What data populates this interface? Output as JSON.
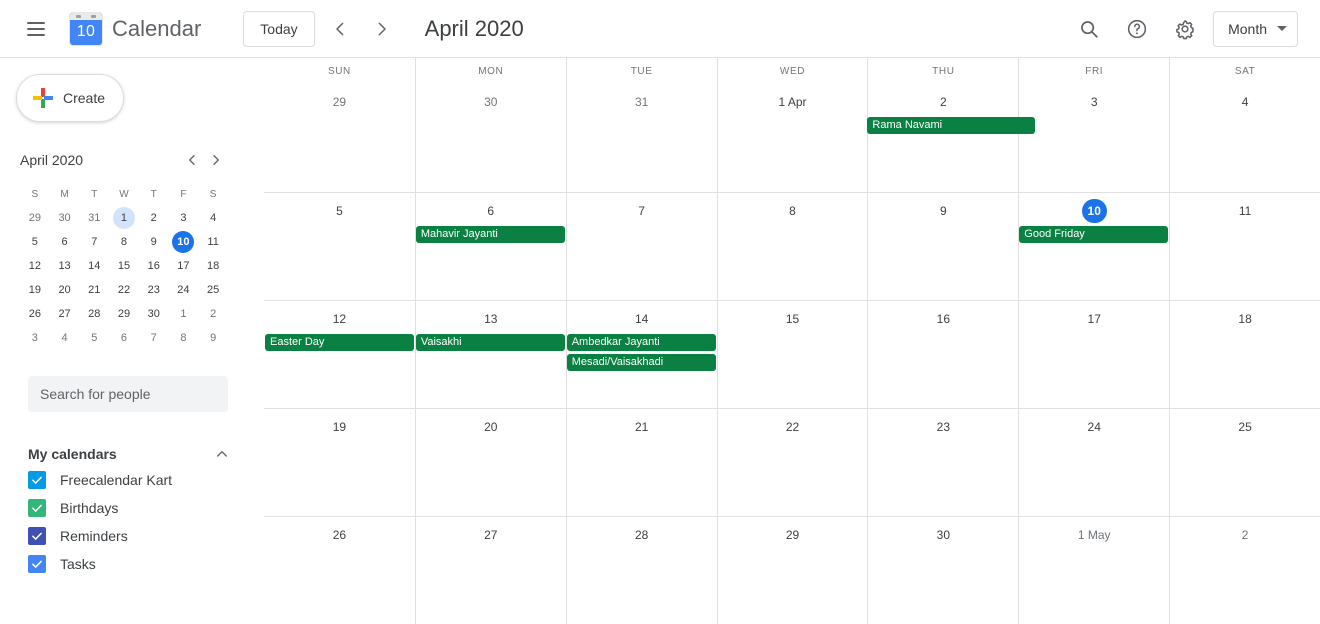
{
  "header": {
    "menu_icon": "hamburger-icon",
    "logo_day": "10",
    "app_title": "Calendar",
    "today_label": "Today",
    "prev_icon": "chevron-left-icon",
    "next_icon": "chevron-right-icon",
    "period_title": "April 2020",
    "search_icon": "search-icon",
    "help_icon": "help-icon",
    "settings_icon": "gear-icon",
    "view_label": "Month",
    "view_caret_icon": "chevron-down-icon"
  },
  "sidebar": {
    "create_label": "Create",
    "create_icon": "plus-icon",
    "mini_calendar": {
      "title": "April 2020",
      "prev_icon": "chevron-left-icon",
      "next_icon": "chevron-right-icon",
      "dow": [
        "S",
        "M",
        "T",
        "W",
        "T",
        "F",
        "S"
      ],
      "weeks": [
        [
          {
            "n": "29",
            "state": "muted"
          },
          {
            "n": "30",
            "state": "muted"
          },
          {
            "n": "31",
            "state": "muted"
          },
          {
            "n": "1",
            "state": "sel"
          },
          {
            "n": "2",
            "state": ""
          },
          {
            "n": "3",
            "state": ""
          },
          {
            "n": "4",
            "state": ""
          }
        ],
        [
          {
            "n": "5",
            "state": ""
          },
          {
            "n": "6",
            "state": ""
          },
          {
            "n": "7",
            "state": ""
          },
          {
            "n": "8",
            "state": ""
          },
          {
            "n": "9",
            "state": ""
          },
          {
            "n": "10",
            "state": "today"
          },
          {
            "n": "11",
            "state": ""
          }
        ],
        [
          {
            "n": "12",
            "state": ""
          },
          {
            "n": "13",
            "state": ""
          },
          {
            "n": "14",
            "state": ""
          },
          {
            "n": "15",
            "state": ""
          },
          {
            "n": "16",
            "state": ""
          },
          {
            "n": "17",
            "state": ""
          },
          {
            "n": "18",
            "state": ""
          }
        ],
        [
          {
            "n": "19",
            "state": ""
          },
          {
            "n": "20",
            "state": ""
          },
          {
            "n": "21",
            "state": ""
          },
          {
            "n": "22",
            "state": ""
          },
          {
            "n": "23",
            "state": ""
          },
          {
            "n": "24",
            "state": ""
          },
          {
            "n": "25",
            "state": ""
          }
        ],
        [
          {
            "n": "26",
            "state": ""
          },
          {
            "n": "27",
            "state": ""
          },
          {
            "n": "28",
            "state": ""
          },
          {
            "n": "29",
            "state": ""
          },
          {
            "n": "30",
            "state": ""
          },
          {
            "n": "1",
            "state": "muted"
          },
          {
            "n": "2",
            "state": "muted"
          }
        ],
        [
          {
            "n": "3",
            "state": "muted"
          },
          {
            "n": "4",
            "state": "muted"
          },
          {
            "n": "5",
            "state": "muted"
          },
          {
            "n": "6",
            "state": "muted"
          },
          {
            "n": "7",
            "state": "muted"
          },
          {
            "n": "8",
            "state": "muted"
          },
          {
            "n": "9",
            "state": "muted"
          }
        ]
      ]
    },
    "people_search_placeholder": "Search for people",
    "my_calendars": {
      "title": "My calendars",
      "collapse_icon": "chevron-up-icon",
      "items": [
        {
          "label": "Freecalendar Kart",
          "color": "#039be5",
          "checked": true
        },
        {
          "label": "Birthdays",
          "color": "#33b679",
          "checked": true
        },
        {
          "label": "Reminders",
          "color": "#3f51b5",
          "checked": true
        },
        {
          "label": "Tasks",
          "color": "#4285f4",
          "checked": true
        }
      ]
    }
  },
  "calendar": {
    "accent_color": "#1a73e8",
    "event_color": "#0b8043",
    "day_headers": [
      "SUN",
      "MON",
      "TUE",
      "WED",
      "THU",
      "FRI",
      "SAT"
    ],
    "weeks": [
      {
        "days": [
          {
            "n": "29",
            "state": "muted"
          },
          {
            "n": "30",
            "state": "muted"
          },
          {
            "n": "31",
            "state": "muted"
          },
          {
            "n": "1 Apr",
            "state": ""
          },
          {
            "n": "2",
            "state": ""
          },
          {
            "n": "3",
            "state": ""
          },
          {
            "n": "4",
            "state": ""
          }
        ],
        "events": [
          {
            "title": "Rama Navami",
            "col": 4,
            "span": 1,
            "row": 0,
            "wide": true
          }
        ]
      },
      {
        "days": [
          {
            "n": "5",
            "state": ""
          },
          {
            "n": "6",
            "state": ""
          },
          {
            "n": "7",
            "state": ""
          },
          {
            "n": "8",
            "state": ""
          },
          {
            "n": "9",
            "state": ""
          },
          {
            "n": "10",
            "state": "today"
          },
          {
            "n": "11",
            "state": ""
          }
        ],
        "events": [
          {
            "title": "Mahavir Jayanti",
            "col": 1,
            "span": 1,
            "row": 0,
            "wide": false
          },
          {
            "title": "Good Friday",
            "col": 5,
            "span": 1,
            "row": 0,
            "wide": false
          }
        ]
      },
      {
        "days": [
          {
            "n": "12",
            "state": ""
          },
          {
            "n": "13",
            "state": ""
          },
          {
            "n": "14",
            "state": ""
          },
          {
            "n": "15",
            "state": ""
          },
          {
            "n": "16",
            "state": ""
          },
          {
            "n": "17",
            "state": ""
          },
          {
            "n": "18",
            "state": ""
          }
        ],
        "events": [
          {
            "title": "Easter Day",
            "col": 0,
            "span": 1,
            "row": 0,
            "wide": false
          },
          {
            "title": "Vaisakhi",
            "col": 1,
            "span": 1,
            "row": 0,
            "wide": false
          },
          {
            "title": "Ambedkar Jayanti",
            "col": 2,
            "span": 1,
            "row": 0,
            "wide": false
          },
          {
            "title": "Mesadi/Vaisakhadi",
            "col": 2,
            "span": 1,
            "row": 1,
            "wide": false
          }
        ]
      },
      {
        "days": [
          {
            "n": "19",
            "state": ""
          },
          {
            "n": "20",
            "state": ""
          },
          {
            "n": "21",
            "state": ""
          },
          {
            "n": "22",
            "state": ""
          },
          {
            "n": "23",
            "state": ""
          },
          {
            "n": "24",
            "state": ""
          },
          {
            "n": "25",
            "state": ""
          }
        ],
        "events": []
      },
      {
        "days": [
          {
            "n": "26",
            "state": ""
          },
          {
            "n": "27",
            "state": ""
          },
          {
            "n": "28",
            "state": ""
          },
          {
            "n": "29",
            "state": ""
          },
          {
            "n": "30",
            "state": ""
          },
          {
            "n": "1 May",
            "state": "muted"
          },
          {
            "n": "2",
            "state": "muted"
          }
        ],
        "events": []
      }
    ]
  }
}
